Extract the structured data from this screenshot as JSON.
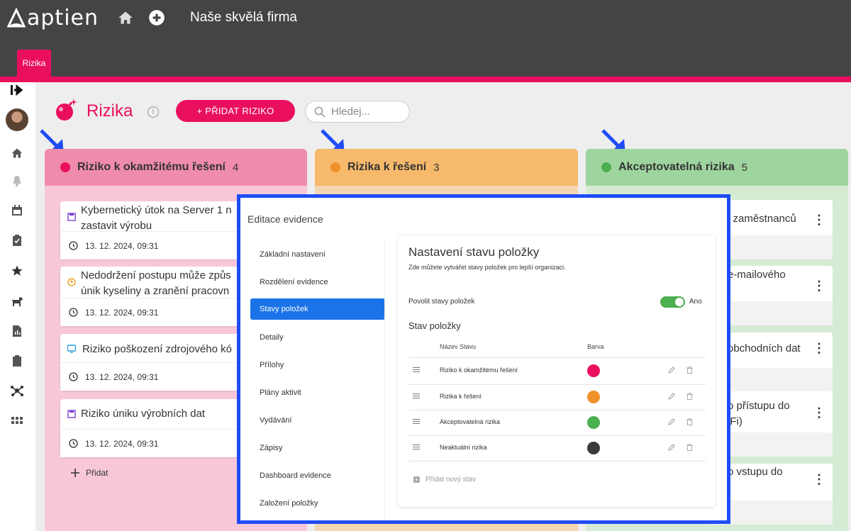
{
  "app": {
    "brand": "aptien",
    "company": "Naše skvělá firma",
    "tab": "Rizika"
  },
  "page": {
    "title": "Rizika",
    "add_button": "+ PŘIDAT RIZIKO",
    "search_placeholder": "Hledej...",
    "info": "i"
  },
  "columns": [
    {
      "name": "Riziko k okamžitému řešení",
      "count": "4",
      "color": "#ea0f5e",
      "cards": [
        {
          "title": "Kybernetický útok na Server 1 n",
          "title2": "zastavit výrobu",
          "date": "13. 12. 2024, 09:31"
        },
        {
          "title": "Nedodržení postupu může způs",
          "title2": "únik kyseliny a zranění pracovn",
          "date": "13. 12. 2024, 09:31"
        },
        {
          "title": "Riziko poškození zdrojového kó",
          "title2": "",
          "date": "13. 12. 2024, 09:31"
        },
        {
          "title": "Riziko úniku výrobních dat",
          "title2": "",
          "date": "13. 12. 2024, 09:31"
        }
      ],
      "add_label": "Přidat"
    },
    {
      "name": "Rizika k řešení",
      "count": "3",
      "color": "#f0902a"
    },
    {
      "name": "Akceptovatelná rizika",
      "count": "5",
      "color": "#4caf50",
      "cards": [
        {
          "title": "i zaměstnanců",
          "title2": ""
        },
        {
          "title": "e-mailového",
          "title2": ""
        },
        {
          "title": "obchodních dat",
          "title2": ""
        },
        {
          "title": "o přístupu do",
          "title2": "iFi)"
        },
        {
          "title": "o vstupu do",
          "title2": ""
        }
      ],
      "menu_icon": "⋮"
    }
  ],
  "modal": {
    "title": "Editace evidence",
    "nav": [
      "Základní nastavení",
      "Rozdělení evidence",
      "Stavy položek",
      "Detaily",
      "Přílohy",
      "Plány aktivit",
      "Vydávání",
      "Zápisy",
      "Dashboard evidence",
      "Založení položky"
    ],
    "active_index": 2,
    "panel": {
      "heading": "Nastavení stavu položky",
      "subtitle": "Zde můžete vytvářet stavy položek pro lepší organizaci.",
      "toggle_label": "Povolit stavy položek",
      "toggle_value": "Ano",
      "section": "Stav položky",
      "col_name": "Název Stavu",
      "col_color": "Barva",
      "states": [
        {
          "name": "Riziko k okamžitému řešení",
          "color": "#ea0f5e"
        },
        {
          "name": "Rizika k řešení",
          "color": "#f0902a"
        },
        {
          "name": "Akceptovatelná rizika",
          "color": "#4caf50"
        },
        {
          "name": "Neaktuální rizika",
          "color": "#3a3a3a"
        }
      ],
      "add_state": "Přidat nový stav"
    }
  }
}
